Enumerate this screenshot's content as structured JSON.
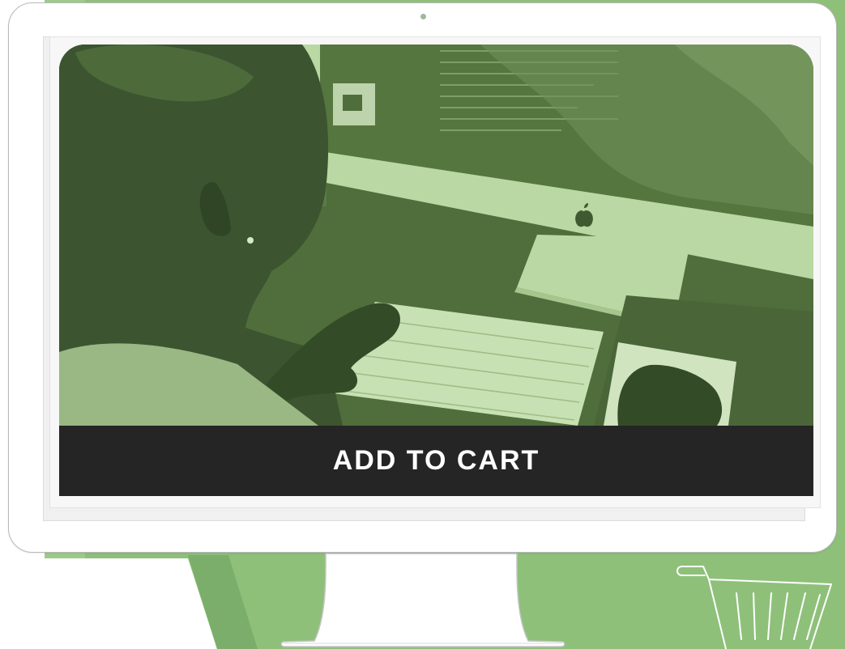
{
  "product": {
    "button_label": "ADD TO CART",
    "photo_subject": "person-typing-at-desktop-computer"
  },
  "icons": {
    "stand": "monitor-stand",
    "cart": "shopping-cart-icon"
  },
  "colors": {
    "background_green": "#8ec07a",
    "background_green_dark": "#7bae6a",
    "photo_tint_light": "#b9d8a3",
    "photo_tint_dark": "#4f6e3c",
    "button_bg": "#252525",
    "button_text": "#ffffff",
    "bezel": "#ffffff"
  }
}
